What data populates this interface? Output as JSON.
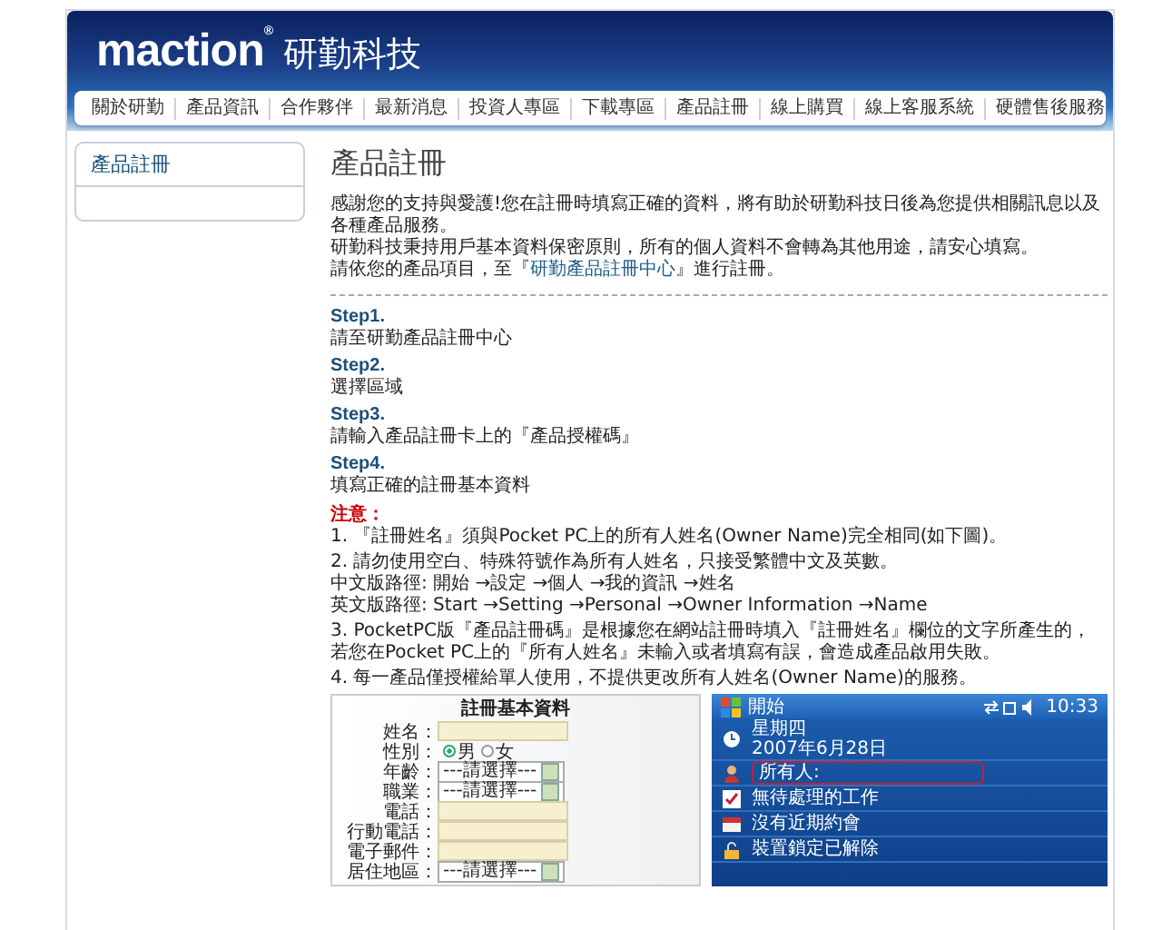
{
  "header": {
    "logo": "maction",
    "registered": "®",
    "company": "研勤科技"
  },
  "nav": [
    {
      "label": "關於研勤"
    },
    {
      "label": "產品資訊"
    },
    {
      "label": "合作夥伴"
    },
    {
      "label": "最新消息"
    },
    {
      "label": "投資人專區"
    },
    {
      "label": "下載專區"
    },
    {
      "label": "產品註冊"
    },
    {
      "label": "線上購買"
    },
    {
      "label": "線上客服系統"
    },
    {
      "label": "硬體售後服務"
    }
  ],
  "sidebar": {
    "items": [
      {
        "label": "產品註冊"
      }
    ]
  },
  "content": {
    "title": "產品註冊",
    "intro": [
      "感謝您的支持與愛護!您在註冊時填寫正確的資料，將有助於研勤科技日後為您提供相關訊息以及各種產品服務。",
      "研勤科技秉持用戶基本資料保密原則，所有的個人資料不會轉為其他用途，請安心填寫。"
    ],
    "intro_link": {
      "before": "請依您的產品項目，至『",
      "link": "研勤產品註冊中心",
      "after": "』進行註冊。"
    },
    "steps": [
      {
        "title": "Step1.",
        "text": "請至研勤產品註冊中心"
      },
      {
        "title": "Step2.",
        "text": "選擇區域"
      },
      {
        "title": "Step3.",
        "text": "請輸入產品註冊卡上的『產品授權碼』"
      },
      {
        "title": "Step4.",
        "text": "填寫正確的註冊基本資料"
      }
    ],
    "notes": {
      "title": "注意：",
      "items": [
        [
          "1. 『註冊姓名』須與Pocket PC上的所有人姓名(Owner Name)完全相同(如下圖)。"
        ],
        [
          "2. 請勿使用空白、特殊符號作為所有人姓名，只接受繁體中文及英數。",
          "中文版路徑: 開始 →設定 →個人 →我的資訊 →姓名",
          "英文版路徑: Start →Setting →Personal →Owner Information →Name"
        ],
        [
          "3. PocketPC版『產品註冊碼』是根據您在網站註冊時填入『註冊姓名』欄位的文字所產生的，若您在Pocket PC上的『所有人姓名』未輸入或者填寫有誤，會造成產品啟用失敗。"
        ],
        [
          "4. 每一產品僅授權給單人使用，不提供更改所有人姓名(Owner Name)的服務。"
        ]
      ]
    }
  },
  "illustration": {
    "form": {
      "title": "註冊基本資料",
      "fields": [
        {
          "label": "姓名：",
          "kind": "text"
        },
        {
          "label": "性別：",
          "kind": "radio",
          "options": [
            {
              "label": "男",
              "selected": true
            },
            {
              "label": "女",
              "selected": false
            }
          ]
        },
        {
          "label": "年齡：",
          "kind": "select",
          "value": "---請選擇---"
        },
        {
          "label": "職業：",
          "kind": "select",
          "value": "---請選擇---"
        },
        {
          "label": "電話：",
          "kind": "text"
        },
        {
          "label": "行動電話：",
          "kind": "text"
        },
        {
          "label": "電子郵件：",
          "kind": "text"
        },
        {
          "label": "居住地區：",
          "kind": "select",
          "value": "---請選擇---"
        }
      ]
    },
    "device": {
      "start": "開始",
      "time": "10:33",
      "items": [
        {
          "kind": "clock",
          "lines": [
            "星期四",
            "2007年6月28日"
          ],
          "highlighted": false
        },
        {
          "kind": "owner",
          "lines": [
            "所有人:"
          ],
          "highlighted": true
        },
        {
          "kind": "tasks",
          "lines": [
            "無待處理的工作"
          ],
          "highlighted": false
        },
        {
          "kind": "calendar",
          "lines": [
            "沒有近期約會"
          ],
          "highlighted": false
        },
        {
          "kind": "lock",
          "lines": [
            "裝置鎖定已解除"
          ],
          "highlighted": false
        }
      ]
    }
  }
}
